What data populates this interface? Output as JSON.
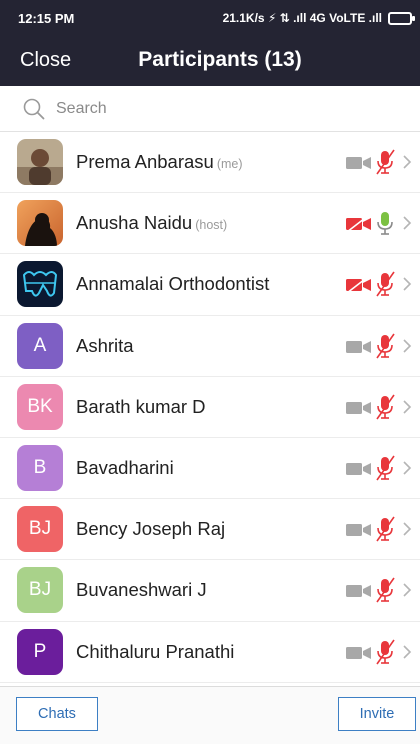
{
  "status_bar": {
    "time": "12:15 PM",
    "indicators": "21.1K/s ⚡ ⇅ .ıll 4G VoLTE .ıll"
  },
  "header": {
    "close_label": "Close",
    "title": "Participants (13)"
  },
  "search": {
    "placeholder": "Search"
  },
  "participants": [
    {
      "name": "Prema Anbarasu",
      "tag": "(me)",
      "avatar": "photo-person",
      "video": "off",
      "mic": "muted"
    },
    {
      "name": "Anusha Naidu",
      "tag": "(host)",
      "avatar": "photo-silhouette",
      "video": "blocked",
      "mic": "on"
    },
    {
      "name": "Annamalai Orthodontist",
      "tag": "",
      "avatar": "photo-logo",
      "video": "blocked",
      "mic": "muted"
    },
    {
      "name": "Ashrita",
      "tag": "",
      "initials": "A",
      "color": "#7e5fc4",
      "video": "off",
      "mic": "muted"
    },
    {
      "name": "Barath kumar D",
      "tag": "",
      "initials": "BK",
      "color": "#ec89b0",
      "video": "off",
      "mic": "muted"
    },
    {
      "name": "Bavadharini",
      "tag": "",
      "initials": "B",
      "color": "#b57fd6",
      "video": "off",
      "mic": "muted"
    },
    {
      "name": "Bency Joseph Raj",
      "tag": "",
      "initials": "BJ",
      "color": "#ef6466",
      "video": "off",
      "mic": "muted"
    },
    {
      "name": "Buvaneshwari J",
      "tag": "",
      "initials": "BJ",
      "color": "#a9d28a",
      "video": "off",
      "mic": "muted"
    },
    {
      "name": "Chithaluru Pranathi",
      "tag": "",
      "initials": "P",
      "color": "#6b1e9c",
      "video": "off",
      "mic": "muted"
    }
  ],
  "footer": {
    "chats_label": "Chats",
    "invite_label": "Invite"
  },
  "colors": {
    "header_bg": "#242433",
    "mute_red": "#e8363b",
    "mic_green": "#7cc142",
    "button_blue": "#2e6db4"
  }
}
